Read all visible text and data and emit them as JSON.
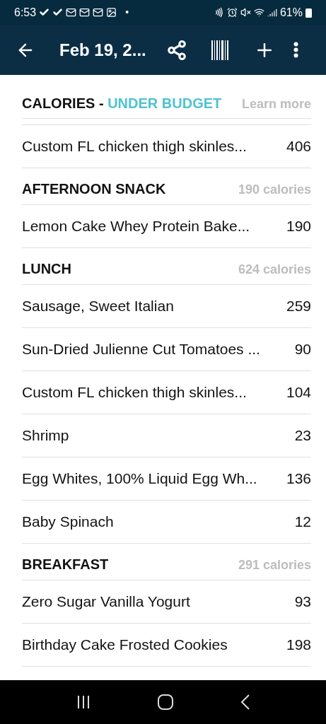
{
  "status_bar": {
    "time": "6:53",
    "dot": "•",
    "battery": "61%"
  },
  "app_bar": {
    "title": "Feb 19, 2..."
  },
  "summary": {
    "label": "CALORIES - ",
    "status": "UNDER BUDGET",
    "link": "Learn more"
  },
  "top_items": [
    {
      "name": "Custom FL chicken thigh skinles...",
      "calories": "406"
    }
  ],
  "meals": [
    {
      "title": "AFTERNOON SNACK",
      "total": "190 calories",
      "items": [
        {
          "name": "Lemon Cake Whey Protein Bake...",
          "calories": "190"
        }
      ]
    },
    {
      "title": "LUNCH",
      "total": "624 calories",
      "items": [
        {
          "name": "Sausage, Sweet Italian",
          "calories": "259"
        },
        {
          "name": "Sun-Dried Julienne Cut Tomatoes ...",
          "calories": "90"
        },
        {
          "name": "Custom FL chicken thigh skinles...",
          "calories": "104"
        },
        {
          "name": "Shrimp",
          "calories": "23"
        },
        {
          "name": "Egg Whites, 100% Liquid Egg Wh...",
          "calories": "136"
        },
        {
          "name": "Baby Spinach",
          "calories": "12"
        }
      ]
    },
    {
      "title": "BREAKFAST",
      "total": "291 calories",
      "items": [
        {
          "name": "Zero Sugar Vanilla Yogurt",
          "calories": "93"
        },
        {
          "name": "Birthday Cake Frosted Cookies",
          "calories": "198"
        }
      ]
    }
  ]
}
